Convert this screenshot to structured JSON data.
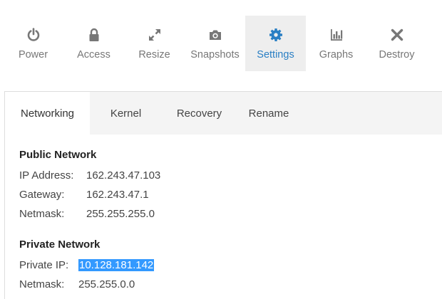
{
  "toolbar": {
    "items": [
      {
        "label": "Power",
        "icon": "power-icon"
      },
      {
        "label": "Access",
        "icon": "lock-icon"
      },
      {
        "label": "Resize",
        "icon": "resize-icon"
      },
      {
        "label": "Snapshots",
        "icon": "camera-icon"
      },
      {
        "label": "Settings",
        "icon": "gear-icon",
        "active": true
      },
      {
        "label": "Graphs",
        "icon": "bar-chart-icon"
      },
      {
        "label": "Destroy",
        "icon": "close-icon"
      }
    ]
  },
  "settings": {
    "tabs": [
      {
        "label": "Networking",
        "active": true
      },
      {
        "label": "Kernel"
      },
      {
        "label": "Recovery"
      },
      {
        "label": "Rename"
      }
    ],
    "public_network": {
      "title": "Public Network",
      "ip_label": "IP Address:",
      "ip_value": "162.243.47.103",
      "gateway_label": "Gateway:",
      "gateway_value": "162.243.47.1",
      "netmask_label": "Netmask:",
      "netmask_value": "255.255.255.0"
    },
    "private_network": {
      "title": "Private Network",
      "ip_label": "Private IP:",
      "ip_value": "10.128.181.142",
      "netmask_label": "Netmask:",
      "netmask_value": "255.255.0.0"
    }
  },
  "colors": {
    "accent": "#2a7fc4",
    "active_tab_bg": "#eeeeee",
    "selection": "#3399ff"
  }
}
